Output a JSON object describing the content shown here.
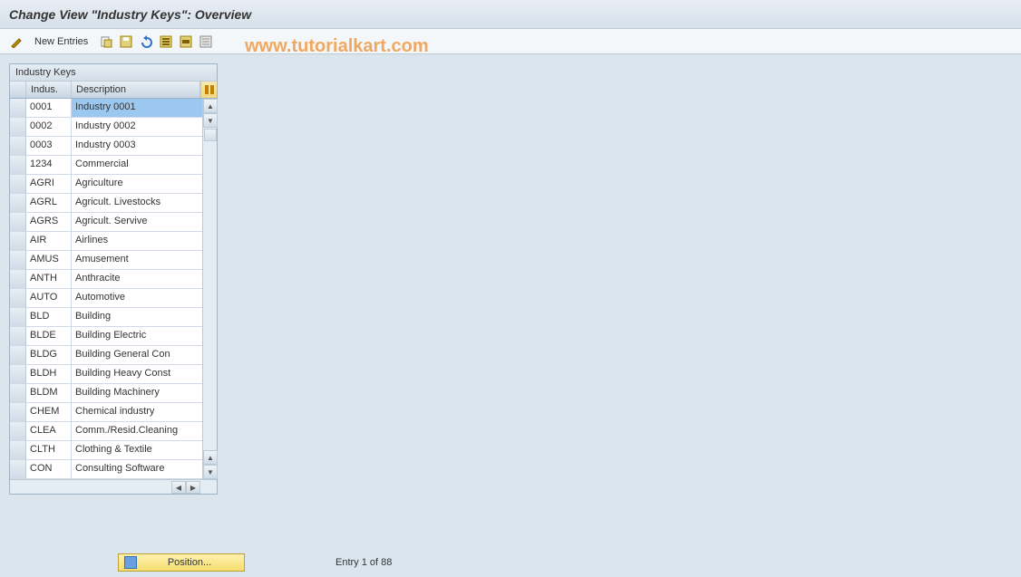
{
  "title": "Change View \"Industry Keys\": Overview",
  "toolbar": {
    "new_entries_label": "New Entries",
    "icons": [
      "pencil-icon",
      "copy-icon",
      "save-icon",
      "undo-icon",
      "selectall-icon",
      "selectblock-icon",
      "deselect-icon"
    ]
  },
  "watermark": "www.tutorialkart.com",
  "table": {
    "title": "Industry Keys",
    "columns": {
      "indus": "Indus.",
      "desc": "Description"
    },
    "rows": [
      {
        "indus": "0001",
        "desc": "Industry 0001",
        "selected": true
      },
      {
        "indus": "0002",
        "desc": "Industry 0002"
      },
      {
        "indus": "0003",
        "desc": "Industry 0003"
      },
      {
        "indus": "1234",
        "desc": "Commercial"
      },
      {
        "indus": "AGRI",
        "desc": "Agriculture"
      },
      {
        "indus": "AGRL",
        "desc": "Agricult. Livestocks"
      },
      {
        "indus": "AGRS",
        "desc": "Agricult. Servive"
      },
      {
        "indus": "AIR",
        "desc": "Airlines"
      },
      {
        "indus": "AMUS",
        "desc": "Amusement"
      },
      {
        "indus": "ANTH",
        "desc": "Anthracite"
      },
      {
        "indus": "AUTO",
        "desc": "Automotive"
      },
      {
        "indus": "BLD",
        "desc": "Building"
      },
      {
        "indus": "BLDE",
        "desc": "Building Electric"
      },
      {
        "indus": "BLDG",
        "desc": "Building General Con"
      },
      {
        "indus": "BLDH",
        "desc": "Building Heavy Const"
      },
      {
        "indus": "BLDM",
        "desc": "Building Machinery"
      },
      {
        "indus": "CHEM",
        "desc": "Chemical industry"
      },
      {
        "indus": "CLEA",
        "desc": "Comm./Resid.Cleaning"
      },
      {
        "indus": "CLTH",
        "desc": "Clothing & Textile"
      },
      {
        "indus": "CON",
        "desc": "Consulting Software"
      }
    ]
  },
  "footer": {
    "position_label": "Position...",
    "entry_text": "Entry 1 of 88"
  }
}
